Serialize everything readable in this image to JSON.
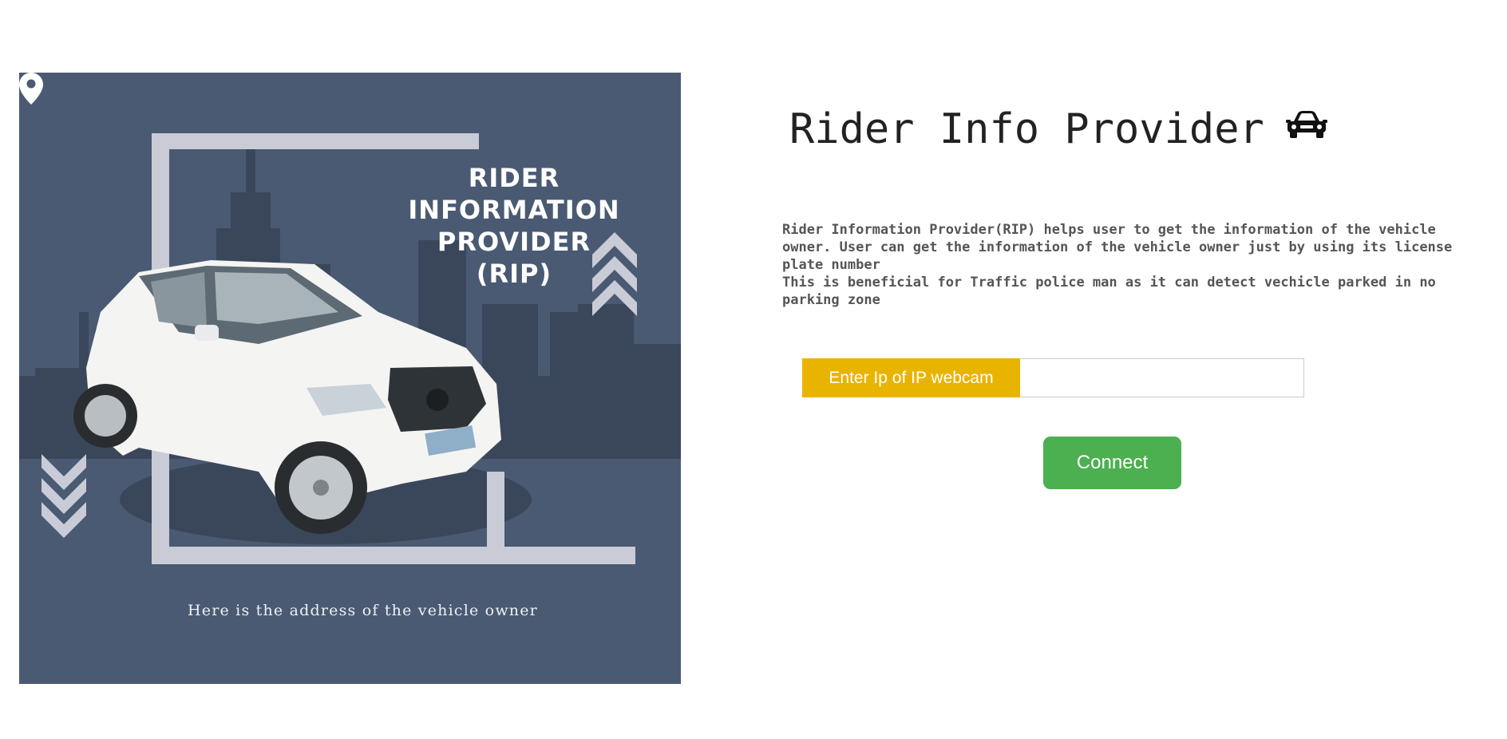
{
  "poster": {
    "title": "RIDER\nINFORMATION\nPROVIDER\n(RIP)",
    "address_text": "Here is the address of the vehicle owner",
    "background_color": "#4a5a73",
    "frame_color": "#c9cbd6"
  },
  "header": {
    "title": "Rider Info Provider",
    "icon": "car-icon"
  },
  "description": {
    "line1": "Rider Information Provider(RIP) helps user to get the information of the vehicle owner. User can get the information of the vehicle owner just by using its license plate number",
    "line2": "This is beneficial for Traffic police man as it can detect vechicle parked in no parking zone"
  },
  "form": {
    "ip_label": "Enter Ip of IP webcam",
    "ip_value": "",
    "ip_placeholder": "",
    "connect_label": "Connect",
    "label_color": "#e9b400",
    "button_color": "#4caf50"
  }
}
